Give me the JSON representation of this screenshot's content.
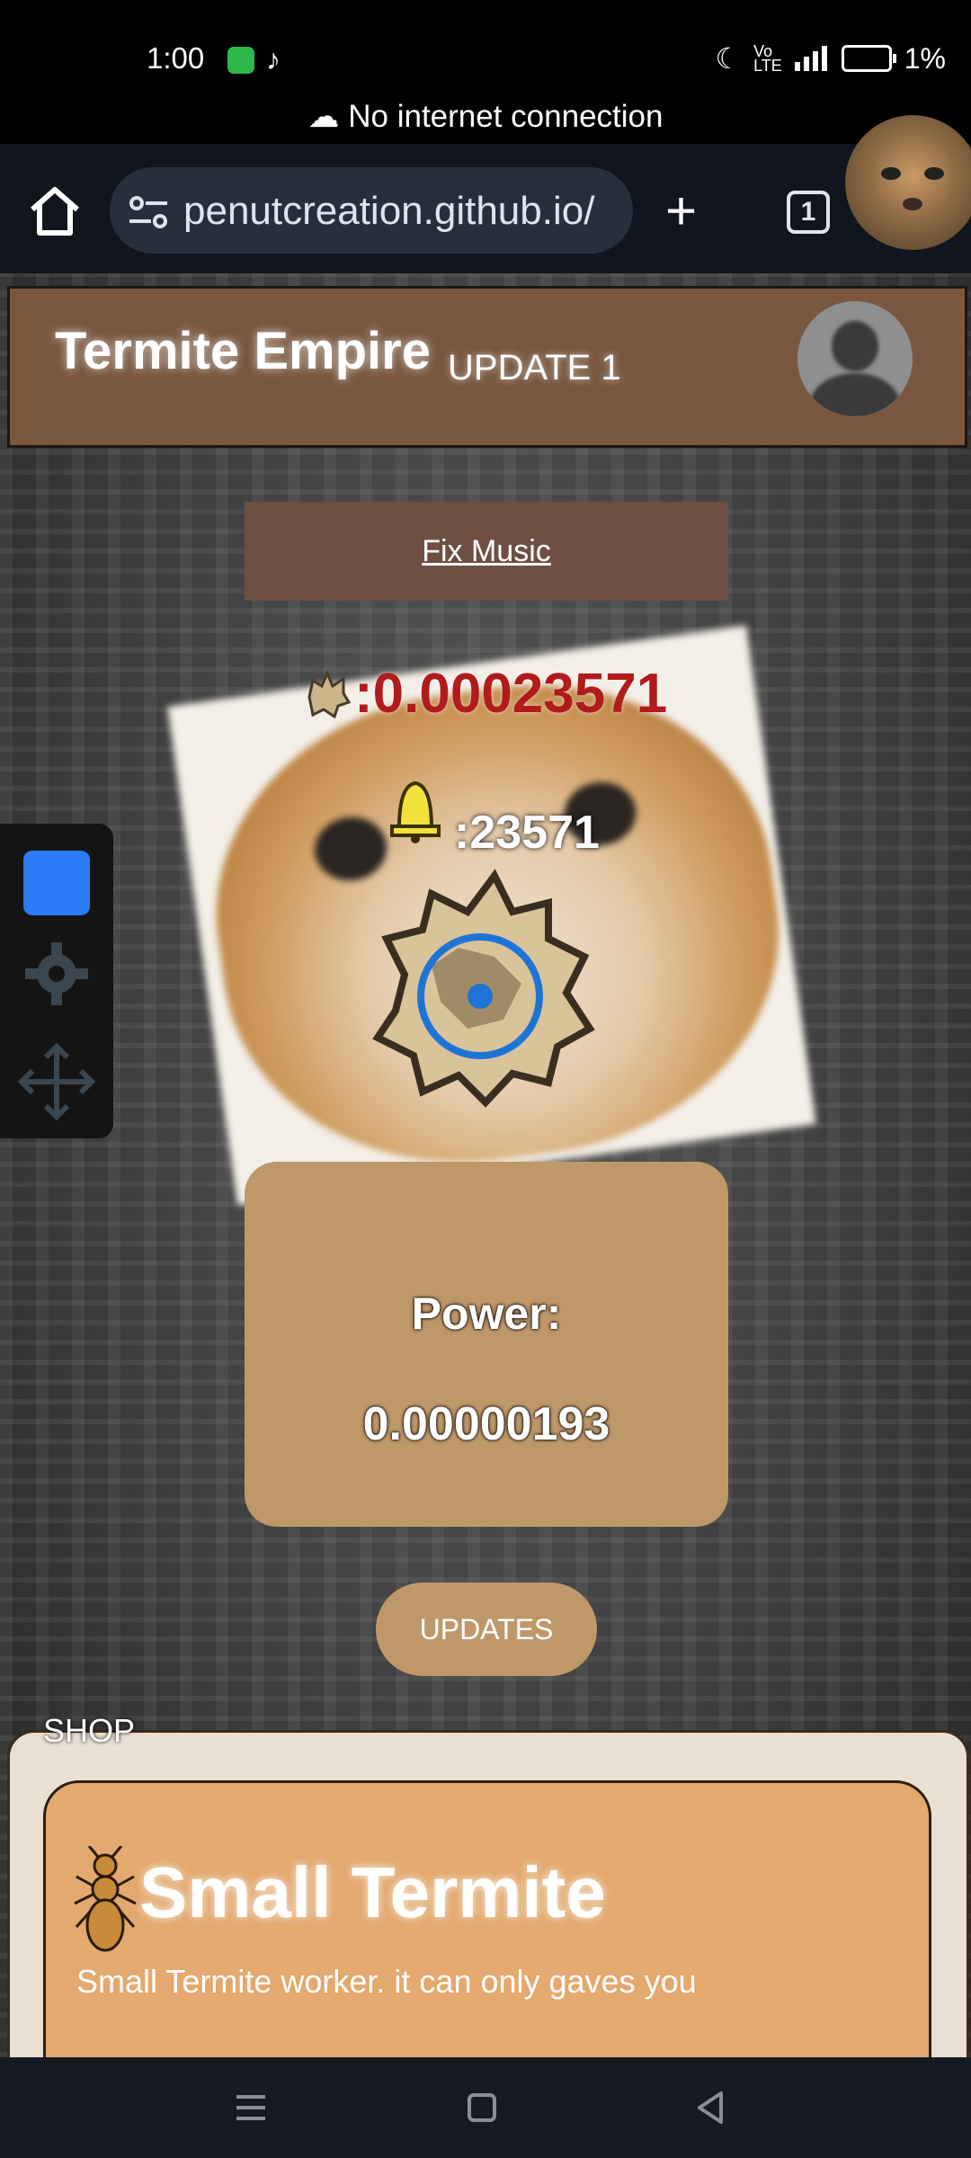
{
  "status_bar": {
    "time": "1:00",
    "battery": "1%",
    "connection_notice": "No internet connection",
    "app_icons": [
      "app-icon",
      "tiktok-icon"
    ],
    "status_icons": [
      "moon-icon",
      "volte-icon",
      "signal-icon",
      "battery-icon"
    ]
  },
  "browser": {
    "url": "penutcreation.github.io/",
    "tab_count": "1",
    "new_tab_label": "+"
  },
  "page": {
    "title": "Termite Empire",
    "update_label": "UPDATE 1",
    "fix_music": "Fix Music",
    "coins": ":0.00023571",
    "bells": ":23571",
    "power_label": "Power:",
    "power_value": "0.00000193",
    "updates_button": "UPDATES",
    "shop_label": "SHOP",
    "shop_item": {
      "name": "Small Termite",
      "description": "Small Termite worker. it can only gaves you"
    }
  },
  "colors": {
    "header_bg": "#7a5840",
    "accent_tan": "#bf986a",
    "coin_red": "#b01b1b",
    "card_orange": "#e3a96f",
    "spinner_blue": "#1e74d6"
  }
}
